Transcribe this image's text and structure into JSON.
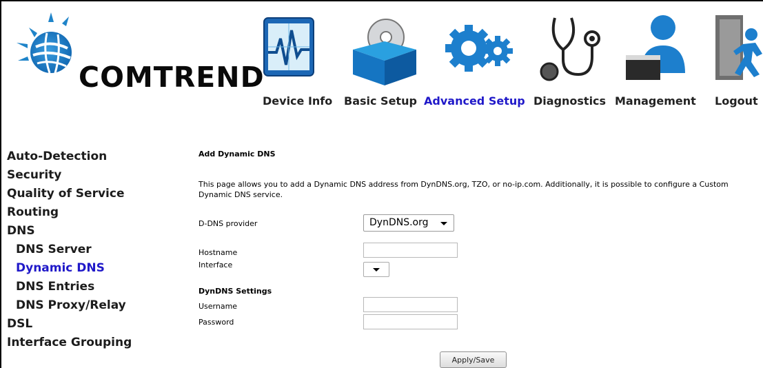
{
  "brand": {
    "name": "COMTREND"
  },
  "nav": [
    {
      "label": "Device Info",
      "icon": "chart-monitor-icon"
    },
    {
      "label": "Basic Setup",
      "icon": "box-disc-icon"
    },
    {
      "label": "Advanced Setup",
      "icon": "gears-icon",
      "active": true
    },
    {
      "label": "Diagnostics",
      "icon": "stethoscope-icon"
    },
    {
      "label": "Management",
      "icon": "user-management-icon"
    },
    {
      "label": "Logout",
      "icon": "exit-door-icon"
    }
  ],
  "sidebar": [
    {
      "label": "Auto-Detection"
    },
    {
      "label": "Security"
    },
    {
      "label": "Quality of Service"
    },
    {
      "label": "Routing"
    },
    {
      "label": "DNS"
    },
    {
      "label": "DNS Server",
      "sub": true
    },
    {
      "label": "Dynamic DNS",
      "sub": true,
      "active": true
    },
    {
      "label": "DNS Entries",
      "sub": true
    },
    {
      "label": "DNS Proxy/Relay",
      "sub": true
    },
    {
      "label": "DSL"
    },
    {
      "label": "Interface Grouping"
    }
  ],
  "page": {
    "title": "Add Dynamic DNS",
    "description": "This page allows you to add a Dynamic DNS address from DynDNS.org, TZO, or no-ip.com. Additionally, it is possible to configure a Custom Dynamic DNS service."
  },
  "form": {
    "provider_label": "D-DNS provider",
    "provider_value": "DynDNS.org",
    "hostname_label": "Hostname",
    "hostname_value": "",
    "interface_label": "Interface",
    "interface_value": "",
    "settings_heading": "DynDNS Settings",
    "username_label": "Username",
    "username_value": "",
    "password_label": "Password",
    "password_value": "",
    "submit_label": "Apply/Save"
  },
  "colors": {
    "active_link": "#2019c9",
    "brand_blue": "#1f84c9"
  }
}
